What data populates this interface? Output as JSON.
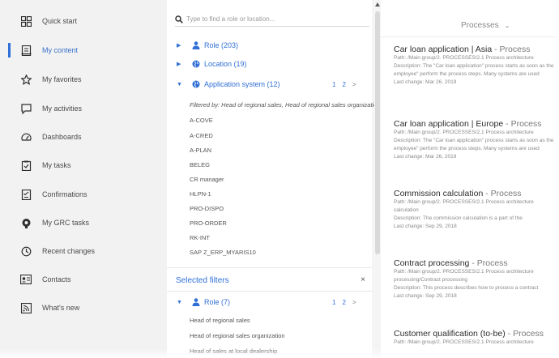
{
  "nav": {
    "items": [
      {
        "label": "Quick start",
        "icon": "grid-icon"
      },
      {
        "label": "My content",
        "icon": "document-icon"
      },
      {
        "label": "My favorites",
        "icon": "star-icon"
      },
      {
        "label": "My activities",
        "icon": "chat-icon"
      },
      {
        "label": "Dashboards",
        "icon": "gauge-icon"
      },
      {
        "label": "My tasks",
        "icon": "clipboard-icon"
      },
      {
        "label": "Confirmations",
        "icon": "checklist-icon"
      },
      {
        "label": "My GRC tasks",
        "icon": "grc-icon"
      },
      {
        "label": "Recent changes",
        "icon": "history-icon"
      },
      {
        "label": "Contacts",
        "icon": "contact-card-icon"
      },
      {
        "label": "What's new",
        "icon": "feed-icon"
      }
    ],
    "active_index": 1,
    "accent_color": "#2f6fd6"
  },
  "search": {
    "placeholder": "Type to find a role or location..."
  },
  "tree": {
    "role": "Role (203)",
    "location": "Location (19)",
    "application_system": "Application system (12)",
    "pager": {
      "page1": "1",
      "page2": "2",
      "next": ">"
    },
    "filter_note": "Filtered by: Head of regional sales, Head of regional sales organization",
    "systems": [
      "A-COVE",
      "A-CRED",
      "A-PLAN",
      "BELEG",
      "CR manager",
      "HLPN-1",
      "PRO-DISPO",
      "PRO-ORDER",
      "RK-INT",
      "SAP Z_ERP_MYARIS10"
    ]
  },
  "selected_filters": {
    "title": "Selected filters",
    "close": "×",
    "role": "Role (7)",
    "pager": {
      "page1": "1",
      "page2": "2",
      "next": ">"
    },
    "roles": [
      "Head of regional sales",
      "Head of regional sales organization",
      "Head of sales at local dealership"
    ]
  },
  "processes": {
    "title": "Processes",
    "chevron": "⌄",
    "results": [
      {
        "name": "Car loan application | Asia",
        "type": "- Process",
        "path": "Path: /Main group/2. PROCESSES/2.1 Process architecture",
        "desc1": "Description: The \"Car loan application\" process starts as soon as the",
        "desc2": "employee\" perform the process steps. Many systems are used",
        "last": "Last change: Mar 26, 2019"
      },
      {
        "name": "Car loan application | Europe",
        "type": "- Process",
        "path": "Path: /Main group/2. PROCESSES/2.1 Process architecture",
        "desc1": "Description: The \"Car loan application\" process starts as soon as the",
        "desc2": "employee\" perform the process steps. Many systems are used",
        "last": "Last change: Mar 26, 2019"
      },
      {
        "name": "Commission calculation",
        "type": "- Process",
        "path": "Path: /Main group/2. PROCESSES/2.1 Process architecture",
        "desc1": "calculation",
        "desc2": "Description: The commission calculation is a part of the",
        "last": "Last change: Sep 29, 2018"
      },
      {
        "name": "Contract processing",
        "type": "- Process",
        "path": "Path: /Main group/2. PROCESSES/2.1 Process architecture",
        "desc1": "processing/Contract processing",
        "desc2": "Description: This process describes how to process a contract",
        "last": "Last change: Sep 29, 2018"
      },
      {
        "name": "Customer qualification (to-be)",
        "type": "- Process",
        "path": "Path: /Main group/2. PROCESSES/2.1 Process architecture",
        "desc1": "",
        "desc2": "",
        "last": ""
      }
    ]
  }
}
